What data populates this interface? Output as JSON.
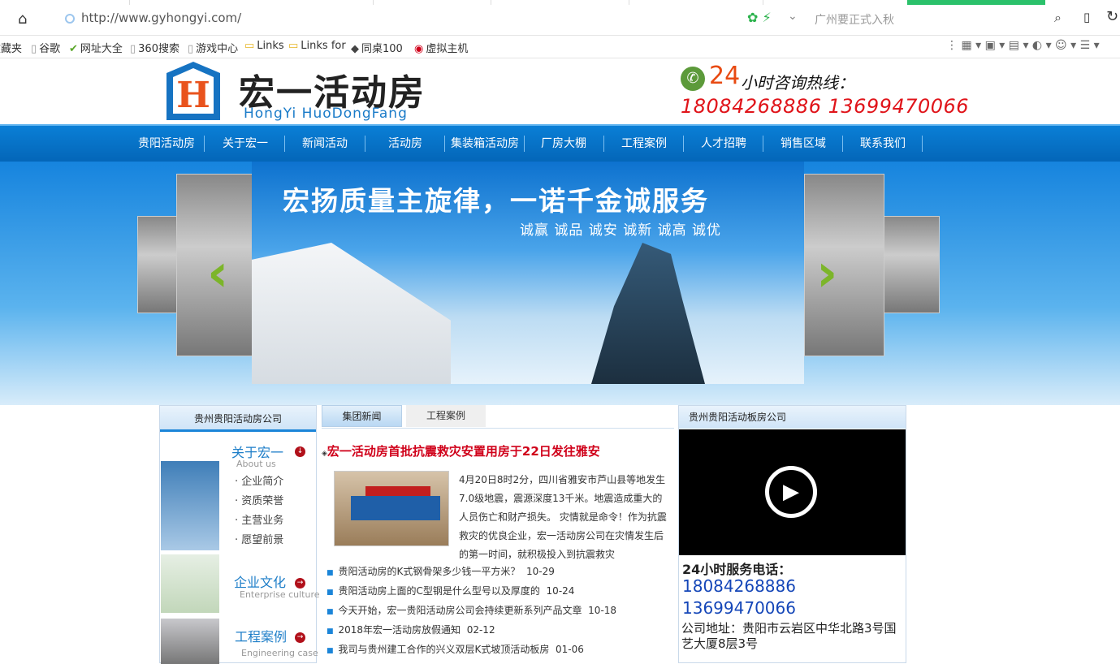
{
  "browser": {
    "url": "http://www.gyhongyi.com/",
    "search_placeholder": "广州要正式入秋"
  },
  "bookmarks": [
    {
      "label": "收藏夹",
      "icon": "star-icon"
    },
    {
      "label": "谷歌",
      "icon": "page-icon"
    },
    {
      "label": "网址大全",
      "icon": "hao-icon"
    },
    {
      "label": "360搜索",
      "icon": "page-icon"
    },
    {
      "label": "游戏中心",
      "icon": "page-icon"
    },
    {
      "label": "Links",
      "icon": "folder-icon"
    },
    {
      "label": "Links for",
      "icon": "folder-icon"
    },
    {
      "label": "同桌100",
      "icon": "graduation-icon"
    },
    {
      "label": "虚拟主机",
      "icon": "globe-icon"
    }
  ],
  "site": {
    "logo_title": "宏一活动房",
    "logo_sub": "HongYi  HuoDongFang",
    "logo_letter": "H",
    "hotline_24": "24",
    "hotline_label": "小时咨询热线：",
    "hotline_numbers": "18084268886  13699470066"
  },
  "nav": [
    "贵阳活动房",
    "关于宏一",
    "新闻活动",
    "活动房",
    "集装箱活动房",
    "厂房大棚",
    "工程案例",
    "人才招聘",
    "销售区域",
    "联系我们"
  ],
  "banner": {
    "title": "宏扬质量主旋律，一诺千金诚服务",
    "subtitle": "诚赢  诚品  诚安  诚新  诚高  诚优"
  },
  "left": {
    "header": "贵州贵阳活动房公司",
    "about_title": "关于宏一",
    "about_en": "About us",
    "links": [
      "企业简介",
      "资质荣誉",
      "主营业务",
      "愿望前景"
    ],
    "culture_title": "企业文化",
    "culture_en": "Enterprise culture",
    "cases_title": "工程案例",
    "cases_en": "Engineering case"
  },
  "middle": {
    "tabs": [
      "集团新闻",
      "工程案例"
    ],
    "headline": "宏一活动房首批抗震救灾安置用房于22日发往雅安",
    "summary": "4月20日8时2分，四川省雅安市芦山县等地发生7.0级地震，震源深度13千米。地震造成重大的人员伤亡和财产损失。 灾情就是命令！作为抗震救灾的优良企业，宏一活动房公司在灾情发生后的第一时间，就积极投入到抗震救灾",
    "news": [
      {
        "title": "贵阳活动房的K式钢骨架多少钱一平方米？",
        "date": "10-29"
      },
      {
        "title": "贵阳活动房上面的C型钢是什么型号以及厚度的",
        "date": "10-24"
      },
      {
        "title": "今天开始，宏一贵阳活动房公司会持续更新系列产品文章",
        "date": "10-18"
      },
      {
        "title": "2018年宏一活动房放假通知",
        "date": "02-12"
      },
      {
        "title": "我司与贵州建工合作的兴义双层K式坡顶活动板房",
        "date": "01-06"
      }
    ]
  },
  "right": {
    "header": "贵州贵阳活动板房公司",
    "service_title": "24小时服务电话：",
    "phones": [
      "18084268886",
      "13699470066"
    ],
    "address": "公司地址：贵阳市云岩区中华北路3号国艺大厦8层3号"
  }
}
